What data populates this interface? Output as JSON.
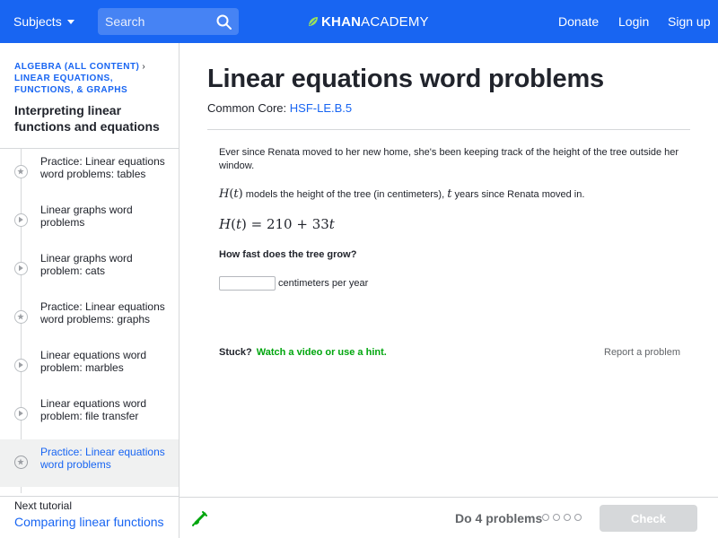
{
  "header": {
    "subjects_label": "Subjects",
    "search_placeholder": "Search",
    "logo_khan": "KHAN",
    "logo_academy": "ACADEMY",
    "donate_label": "Donate",
    "login_label": "Login",
    "signup_label": "Sign up",
    "bar_color": "#1865f2"
  },
  "sidebar": {
    "breadcrumb": {
      "level1": "Algebra (all content)",
      "separator": "›",
      "level2": "Linear equations, functions, & graphs"
    },
    "tutorial_title": "Interpreting linear functions and equations",
    "items": [
      {
        "label": "Practice: Linear equations word problems: tables",
        "icon": "star-icon",
        "active": false
      },
      {
        "label": "Linear graphs word problems",
        "icon": "play-icon",
        "active": false
      },
      {
        "label": "Linear graphs word problem: cats",
        "icon": "play-icon",
        "active": false
      },
      {
        "label": "Practice: Linear equations word problems: graphs",
        "icon": "star-icon",
        "active": false
      },
      {
        "label": "Linear equations word problem: marbles",
        "icon": "play-icon",
        "active": false
      },
      {
        "label": "Linear equations word problem: file transfer",
        "icon": "play-icon",
        "active": false
      },
      {
        "label": "Practice: Linear equations word problems",
        "icon": "star-icon",
        "active": true
      }
    ],
    "next_label": "Next tutorial",
    "next_link": "Comparing linear functions"
  },
  "main": {
    "title": "Linear equations word problems",
    "common_core_label": "Common Core:",
    "common_core_code": "HSF-LE.B.5",
    "problem": {
      "intro": "Ever since Renata moved to her new home, she's been keeping track of the height of the tree outside her window.",
      "func_name": "H",
      "func_var": "t",
      "definition_mid": " models the height of the tree (in centimeters), ",
      "definition_end": " years since Renata moved in.",
      "equation_rhs": "210 + 33",
      "question": "How fast does the tree grow?",
      "answer_value": "",
      "answer_unit": "centimeters per year"
    },
    "stuck_label": "Stuck?",
    "stuck_link": "Watch a video or use a hint.",
    "report_label": "Report a problem"
  },
  "footer": {
    "progress_label": "Do 4 problems",
    "problem_count": 4,
    "check_label": "Check"
  }
}
